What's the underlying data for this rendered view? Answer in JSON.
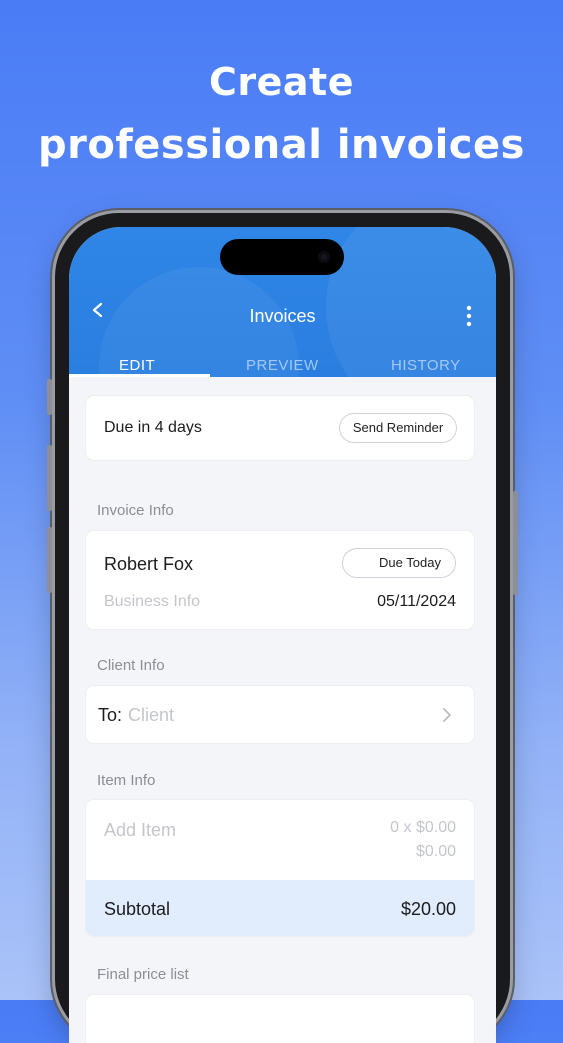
{
  "promo": {
    "line1": "Create",
    "line2": "professional invoices"
  },
  "colors": {
    "accent": "#2a7ee0",
    "background_top": "#4a7cf6",
    "subtotal_bg": "#e1ecfc"
  },
  "appbar": {
    "title": "Invoices",
    "back_icon": "chevron-left-icon",
    "more_icon": "more-vertical-icon",
    "tabs": [
      {
        "label": "EDIT",
        "active": true
      },
      {
        "label": "PREVIEW",
        "active": false
      },
      {
        "label": "HISTORY",
        "active": false
      }
    ]
  },
  "status": {
    "due_text": "Due in 4 days",
    "reminder_label": "Send Reminder"
  },
  "invoice_info": {
    "section_label": "Invoice Info",
    "name": "Robert Fox",
    "due_badge": "Due Today",
    "business_placeholder": "Business Info",
    "date": "05/11/2024"
  },
  "client_info": {
    "section_label": "Client Info",
    "to_label": "To:",
    "client_placeholder": "Client"
  },
  "item_info": {
    "section_label": "Item Info",
    "add_item_placeholder": "Add Item",
    "qty_price": "0 x $0.00",
    "line_total": "$0.00",
    "subtotal_label": "Subtotal",
    "subtotal_value": "$20.00"
  },
  "final_price": {
    "section_label": "Final price list"
  }
}
